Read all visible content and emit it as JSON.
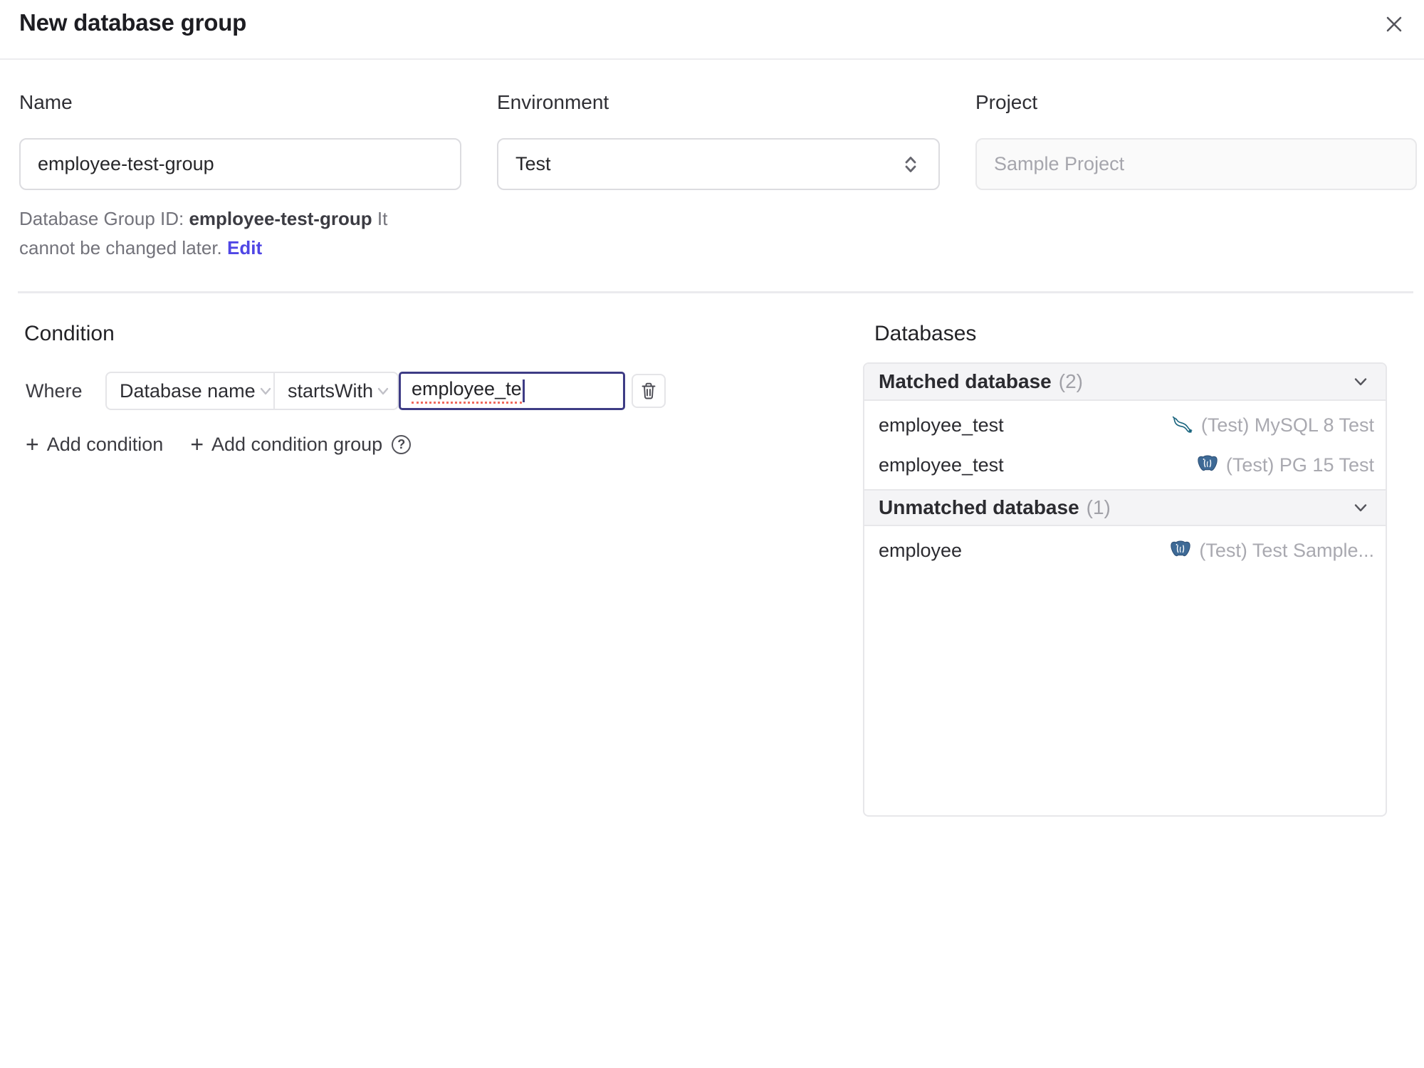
{
  "dialog": {
    "title": "New database group"
  },
  "form": {
    "name": {
      "label": "Name",
      "value": "employee-test-group"
    },
    "environment": {
      "label": "Environment",
      "value": "Test"
    },
    "project": {
      "label": "Project",
      "value": "Sample Project"
    }
  },
  "group_id_note": {
    "prefix": "Database Group ID: ",
    "id": "employee-test-group",
    "suffix": " It cannot be changed later. ",
    "edit_label": "Edit"
  },
  "condition": {
    "heading": "Condition",
    "where_label": "Where",
    "factor": "Database name",
    "operator": "startsWith",
    "value": "employee_te",
    "add_condition": "Add condition",
    "add_condition_group": "Add condition group"
  },
  "databases": {
    "heading": "Databases",
    "sections": [
      {
        "title": "Matched database",
        "count": "(2)",
        "rows": [
          {
            "name": "employee_test",
            "engine": "mysql",
            "instance": "(Test) MySQL 8 Test"
          },
          {
            "name": "employee_test",
            "engine": "postgres",
            "instance": "(Test) PG 15 Test"
          }
        ]
      },
      {
        "title": "Unmatched database",
        "count": "(1)",
        "rows": [
          {
            "name": "employee",
            "engine": "postgres",
            "instance": "(Test) Test Sample..."
          }
        ]
      }
    ]
  },
  "icons": {
    "plus": "+",
    "help": "?"
  },
  "colors": {
    "accent_link": "#4f46e5",
    "focus_border": "#3e3c85",
    "spellcheck_underline": "#ef6a5e",
    "mysql_icon": "#19647e",
    "postgres_icon": "#3e6a96",
    "section_header_bg": "#f4f4f6",
    "border": "#e7e7ea"
  }
}
